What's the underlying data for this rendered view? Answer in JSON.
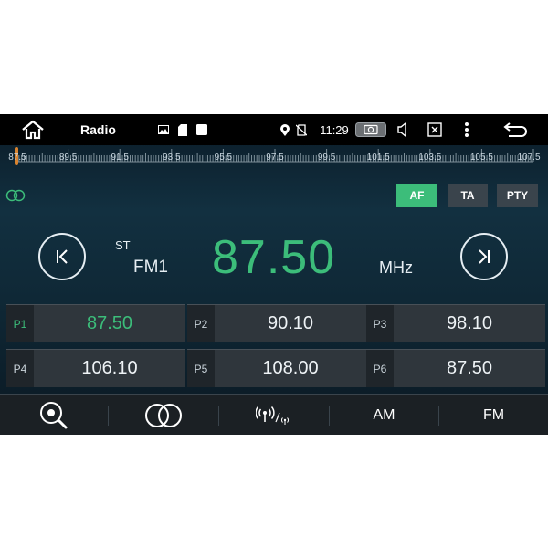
{
  "status_bar": {
    "title": "Radio",
    "time": "11:29",
    "icons": [
      "home-icon",
      "gallery-icon",
      "sd-card-icon",
      "square-notification-icon",
      "location-icon",
      "no-sim-icon",
      "camera-icon",
      "volume-icon",
      "close-window-icon",
      "more-options-icon",
      "back-icon"
    ]
  },
  "tuner": {
    "scale_labels": [
      "87.5",
      "89.5",
      "91.5",
      "93.5",
      "95.5",
      "97.5",
      "99.5",
      "101.5",
      "103.5",
      "105.5",
      "107.5"
    ],
    "scale_min": 87.5,
    "scale_max": 107.5,
    "current": 87.5
  },
  "options": {
    "af": "AF",
    "ta": "TA",
    "pty": "PTY"
  },
  "display": {
    "stereo": "ST",
    "band": "FM1",
    "frequency": "87.50",
    "unit": "MHz"
  },
  "presets": [
    {
      "label": "P1",
      "value": "87.50"
    },
    {
      "label": "P2",
      "value": "90.10"
    },
    {
      "label": "P3",
      "value": "98.10"
    },
    {
      "label": "P4",
      "value": "106.10"
    },
    {
      "label": "P5",
      "value": "108.00"
    },
    {
      "label": "P6",
      "value": "87.50"
    }
  ],
  "bottom_bar": {
    "icons": [
      "search-scan-icon",
      "stereo-icon",
      "broadcast-icon"
    ],
    "am": "AM",
    "fm": "FM"
  },
  "colors": {
    "accent": "#3cbd7a",
    "background": "#0f2836",
    "button": "#3a444c"
  }
}
